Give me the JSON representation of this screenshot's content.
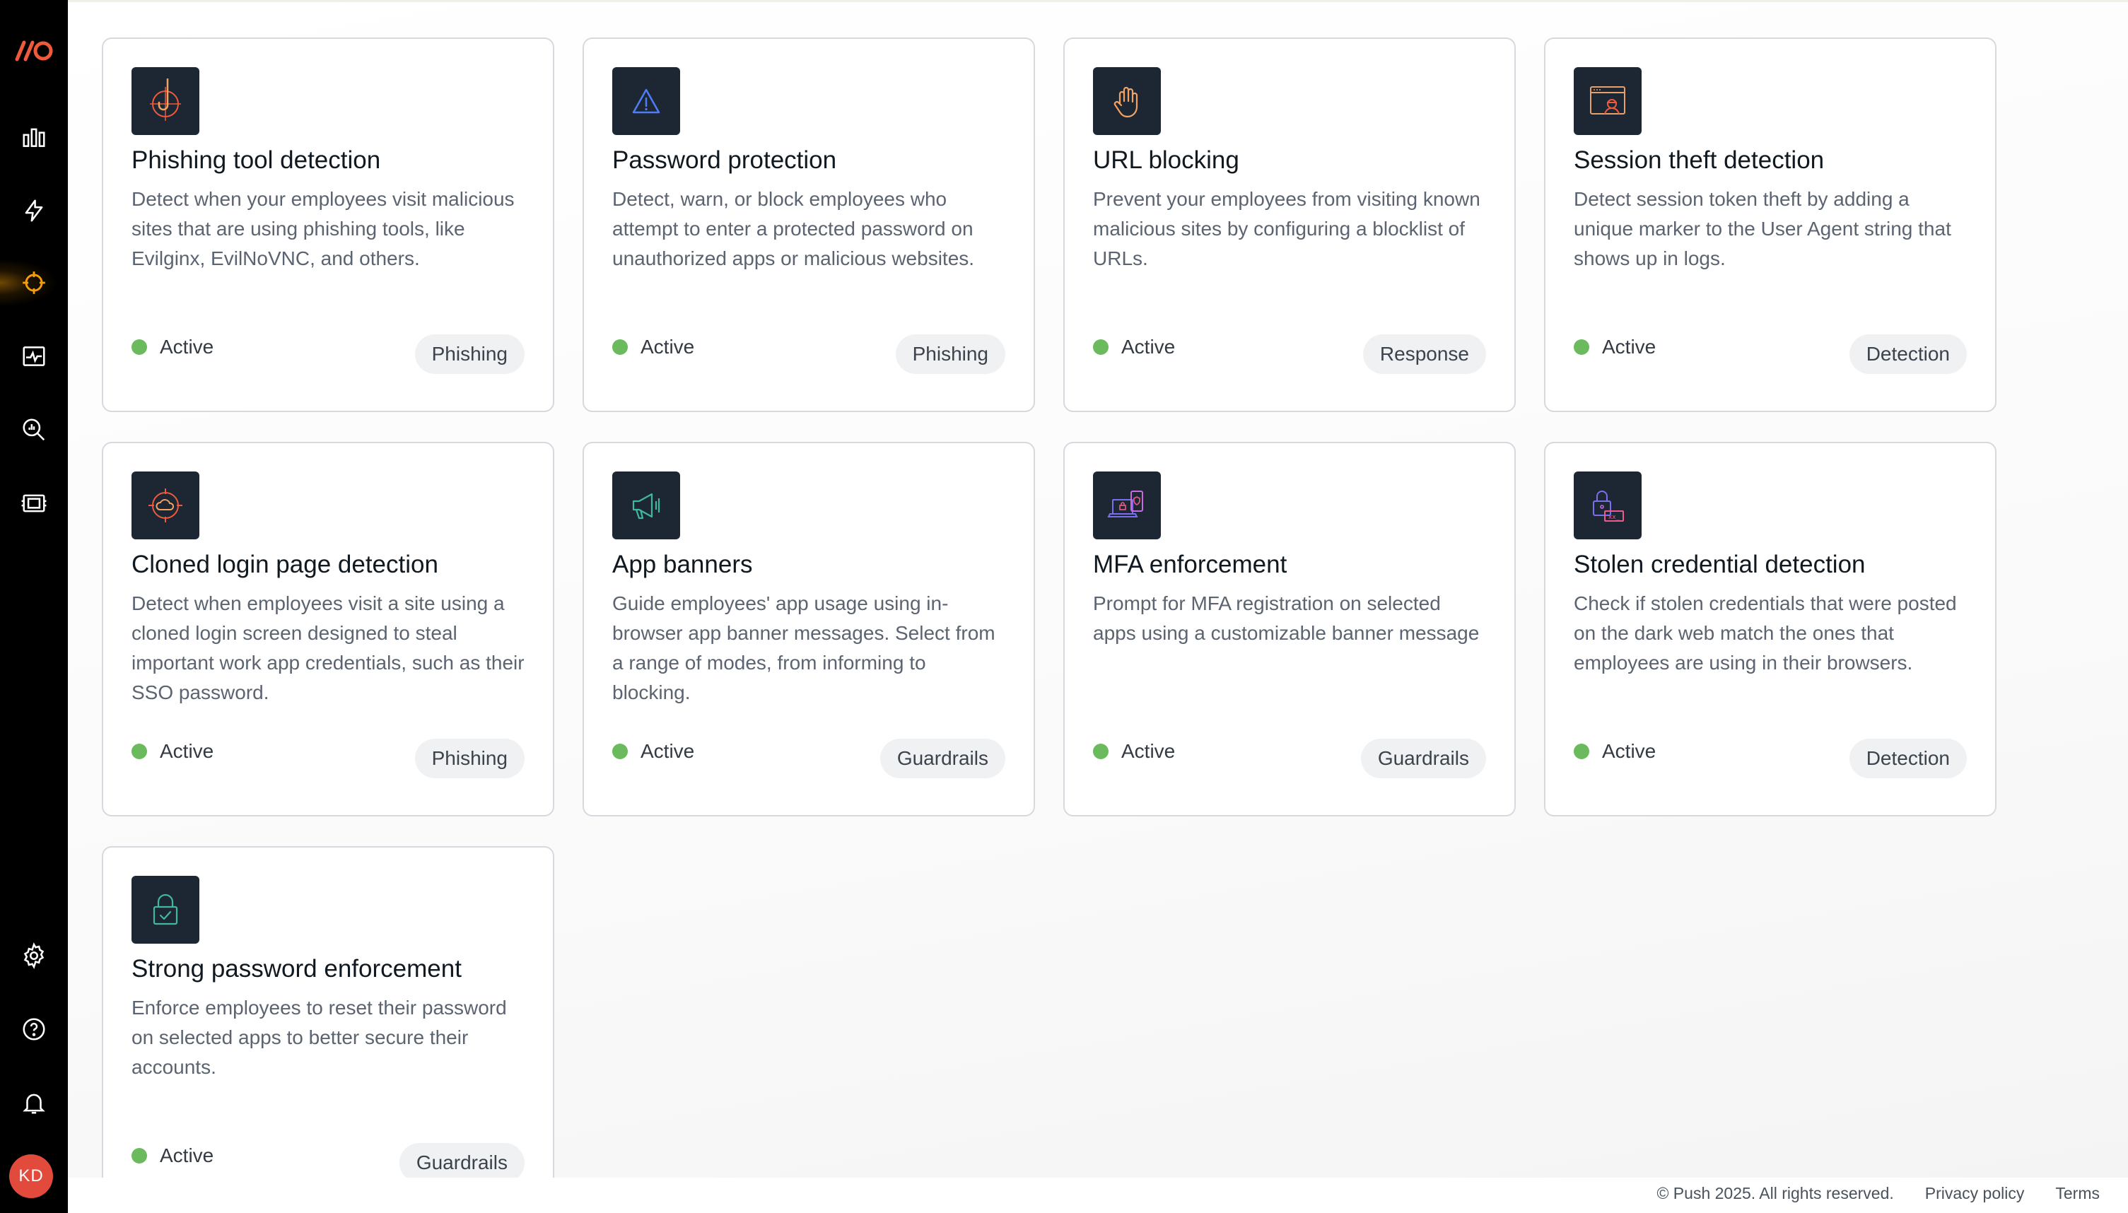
{
  "sidebar": {
    "nav": [
      {
        "name": "analytics",
        "icon": "bar-chart-icon"
      },
      {
        "name": "events",
        "icon": "lightning-icon"
      },
      {
        "name": "controls",
        "icon": "crosshair-icon",
        "active": true
      },
      {
        "name": "monitoring",
        "icon": "activity-monitor-icon"
      },
      {
        "name": "investigate",
        "icon": "search-chart-icon"
      },
      {
        "name": "apps",
        "icon": "app-list-icon"
      }
    ],
    "bottom": [
      {
        "name": "settings",
        "icon": "gear-icon"
      },
      {
        "name": "help",
        "icon": "help-circle-icon"
      },
      {
        "name": "notifications",
        "icon": "bell-icon"
      }
    ],
    "avatar_initials": "KD"
  },
  "cards": [
    {
      "title": "Phishing tool detection",
      "description": "Detect when your employees visit malicious sites that are using phishing tools, like Evilginx, EvilNoVNC, and others.",
      "status": "Active",
      "tag": "Phishing",
      "icon": "fishhook-target-icon"
    },
    {
      "title": "Password protection",
      "description": "Detect, warn, or block employees who attempt to enter a protected password on unauthorized apps or malicious websites.",
      "status": "Active",
      "tag": "Phishing",
      "icon": "warning-triangle-icon"
    },
    {
      "title": "URL blocking",
      "description": "Prevent your employees from visiting known malicious sites by configuring a blocklist of URLs.",
      "status": "Active",
      "tag": "Response",
      "icon": "stop-hand-icon"
    },
    {
      "title": "Session theft detection",
      "description": "Detect session token theft by adding a unique marker to the User Agent string that shows up in logs.",
      "status": "Active",
      "tag": "Detection",
      "icon": "browser-spy-icon"
    },
    {
      "title": "Cloned login page detection",
      "description": "Detect when employees visit a site using a cloned login screen designed to steal important work app credentials, such as their SSO password.",
      "status": "Active",
      "tag": "Phishing",
      "icon": "cloud-target-icon"
    },
    {
      "title": "App banners",
      "description": "Guide employees' app usage using in-browser app banner messages. Select from a range of modes, from informing to blocking.",
      "status": "Active",
      "tag": "Guardrails",
      "icon": "megaphone-icon"
    },
    {
      "title": "MFA enforcement",
      "description": "Prompt for MFA registration on selected apps using a customizable banner message",
      "status": "Active",
      "tag": "Guardrails",
      "icon": "laptop-phone-lock-icon"
    },
    {
      "title": "Stolen credential detection",
      "description": "Check if stolen credentials that were posted on the dark web match the ones that employees are using in their browsers.",
      "status": "Active",
      "tag": "Detection",
      "icon": "lock-password-icon"
    },
    {
      "title": "Strong password enforcement",
      "description": "Enforce employees to reset their password on selected apps to better secure their accounts.",
      "status": "Active",
      "tag": "Guardrails",
      "icon": "lock-check-icon"
    }
  ],
  "footer": {
    "copyright": "© Push 2025. All rights reserved.",
    "privacy": "Privacy policy",
    "terms": "Terms"
  },
  "colors": {
    "sidebar_bg": "#000000",
    "accent": "#f59e0b",
    "status_active": "#6cba5e",
    "icon_tile_bg": "#1c2733"
  }
}
